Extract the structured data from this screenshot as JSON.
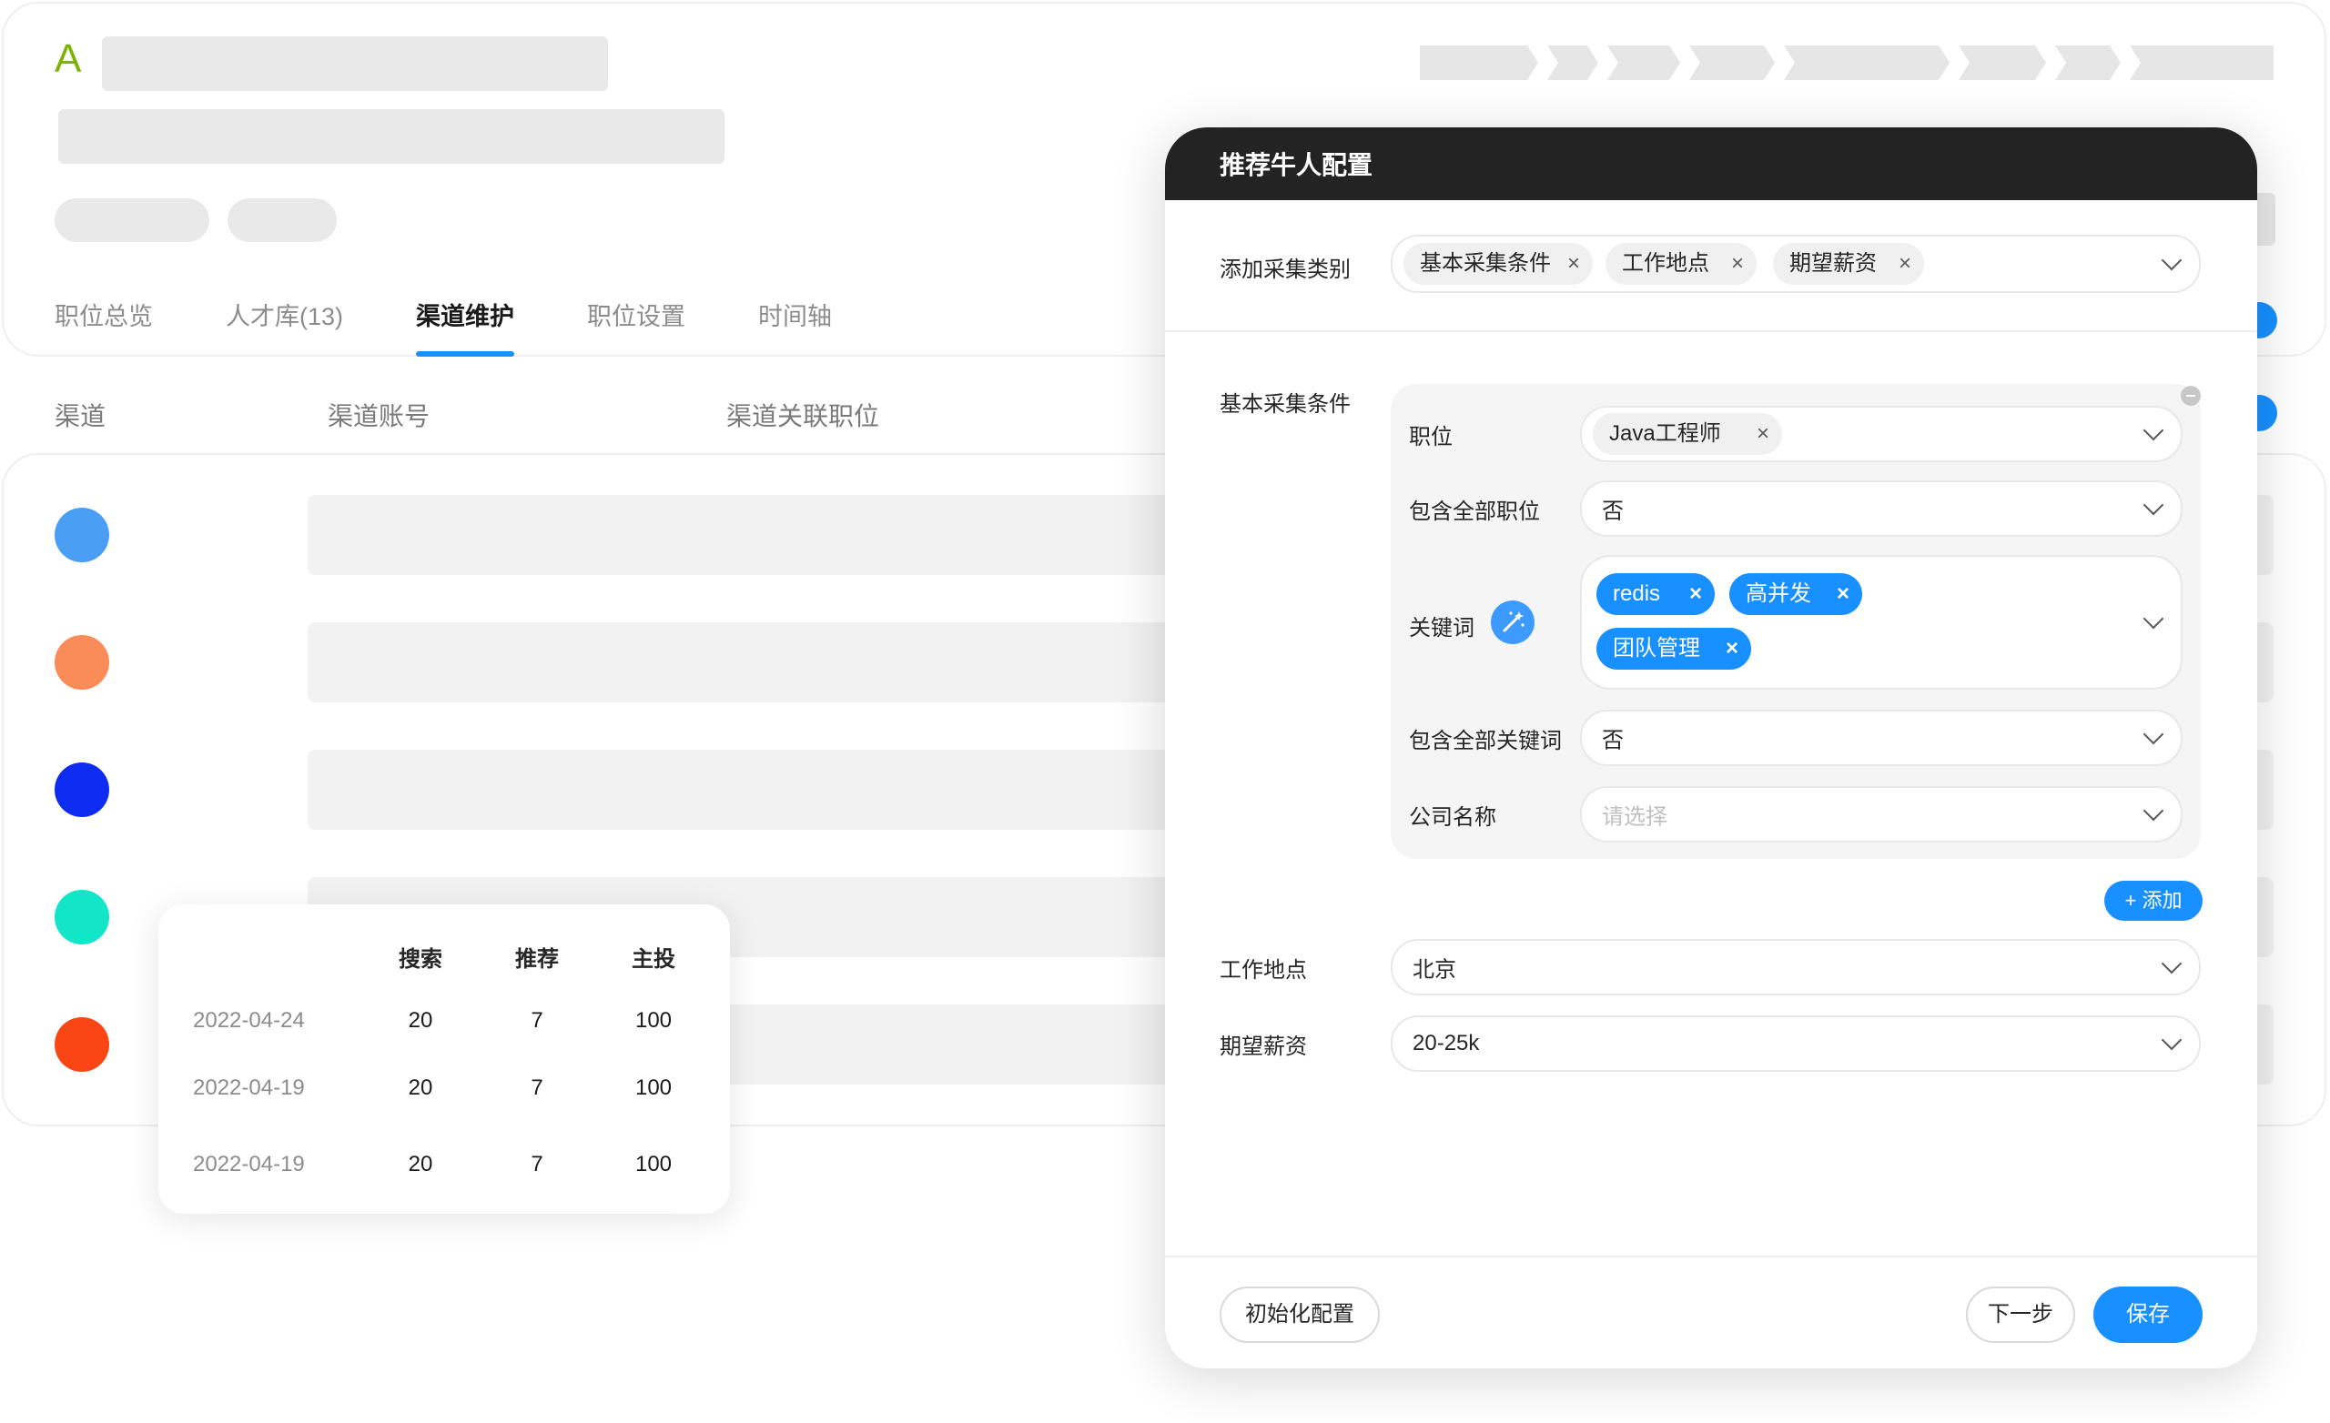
{
  "background": {
    "logo_letter": "A",
    "tabs": [
      {
        "label": "职位总览"
      },
      {
        "label": "人才库(13)"
      },
      {
        "label": "渠道维护"
      },
      {
        "label": "职位设置"
      },
      {
        "label": "时间轴"
      }
    ],
    "active_tab": "渠道维护",
    "columns": {
      "channel": "渠道",
      "account": "渠道账号",
      "linked_position": "渠道关联职位"
    },
    "channel_dot_colors": [
      "#4a9ff5",
      "#fa8c5a",
      "#0d2cf0",
      "#13e6c8",
      "#fa4614"
    ],
    "accent_color": "#1890ff"
  },
  "stats": {
    "headers": [
      "搜索",
      "推荐",
      "主投"
    ],
    "rows": [
      {
        "date": "2022-04-24",
        "search": "20",
        "recommend": "7",
        "main": "100"
      },
      {
        "date": "2022-04-19",
        "search": "20",
        "recommend": "7",
        "main": "100"
      },
      {
        "date": "2022-04-19",
        "search": "20",
        "recommend": "7",
        "main": "100"
      }
    ]
  },
  "modal": {
    "title": "推荐牛人配置",
    "add_category": {
      "label": "添加采集类别",
      "tags": [
        "基本采集条件",
        "工作地点",
        "期望薪资"
      ]
    },
    "basic": {
      "section_label": "基本采集条件",
      "position": {
        "label": "职位",
        "tags": [
          "Java工程师"
        ]
      },
      "include_all_positions": {
        "label": "包含全部职位",
        "value": "否"
      },
      "keywords": {
        "label": "关键词",
        "tags": [
          "redis",
          "高并发",
          "团队管理"
        ]
      },
      "include_all_keywords": {
        "label": "包含全部关键词",
        "value": "否"
      },
      "company": {
        "label": "公司名称",
        "placeholder": "请选择"
      },
      "add_button": "+ 添加"
    },
    "location": {
      "label": "工作地点",
      "value": "北京"
    },
    "salary": {
      "label": "期望薪资",
      "value": "20-25k"
    },
    "footer": {
      "reset": "初始化配置",
      "next": "下一步",
      "save": "保存"
    }
  }
}
